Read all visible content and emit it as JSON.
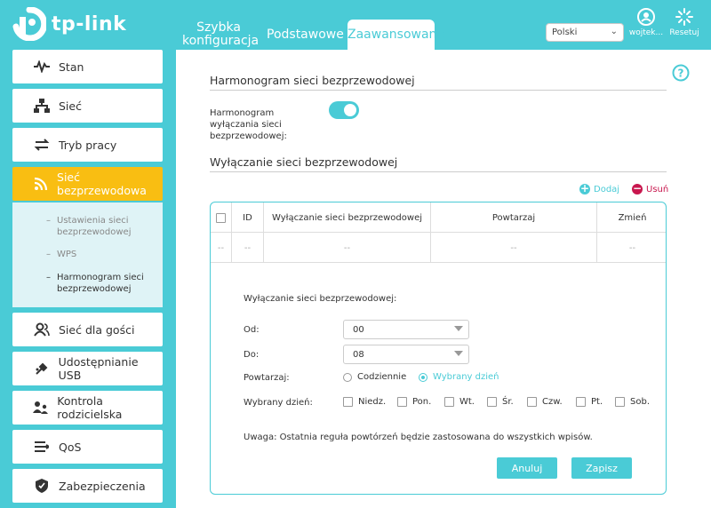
{
  "brand": {
    "name": "tp-link"
  },
  "nav": {
    "tabs": [
      {
        "label": "Szybka konfiguracja"
      },
      {
        "label": "Podstawowe"
      },
      {
        "label": "Zaawansowane"
      }
    ]
  },
  "header": {
    "language": "Polski",
    "user_label": "wojtek...",
    "reset_label": "Resetuj"
  },
  "sidebar": {
    "items": [
      {
        "label": "Stan",
        "icon": "pulse-icon"
      },
      {
        "label": "Sieć",
        "icon": "network-icon"
      },
      {
        "label": "Tryb pracy",
        "icon": "mode-icon"
      },
      {
        "label": "Sieć bezprzewodowa",
        "icon": "wifi-icon"
      },
      {
        "label": "Sieć dla gości",
        "icon": "guests-icon"
      },
      {
        "label": "Udostępnianie USB",
        "icon": "usb-icon"
      },
      {
        "label": "Kontrola rodzicielska",
        "icon": "parental-icon"
      },
      {
        "label": "QoS",
        "icon": "qos-icon"
      },
      {
        "label": "Zabezpieczenia",
        "icon": "shield-icon"
      }
    ],
    "submenu": [
      {
        "label": "Ustawienia sieci bezprzewodowej"
      },
      {
        "label": "WPS"
      },
      {
        "label": "Harmonogram sieci bezprzewodowej"
      }
    ]
  },
  "main": {
    "section1_title": "Harmonogram sieci bezprzewodowej",
    "toggle_label": "Harmonogram wyłączania sieci bezprzewodowej:",
    "section2_title": "Wyłączanie sieci bezprzewodowej",
    "add_label": "Dodaj",
    "delete_label": "Usuń",
    "table": {
      "headers": [
        "ID",
        "Wyłączanie sieci bezprzewodowej",
        "Powtarzaj",
        "Zmień"
      ],
      "row": [
        "--",
        "--",
        "--",
        "--",
        "--"
      ]
    },
    "form": {
      "title": "Wyłączanie sieci bezprzewodowej:",
      "from_label": "Od:",
      "from_value": "00",
      "to_label": "Do:",
      "to_value": "08",
      "repeat_label": "Powtarzaj:",
      "repeat_daily": "Codziennie",
      "repeat_selected": "Wybrany dzień",
      "days_label": "Wybrany dzień:",
      "days": [
        "Niedz.",
        "Pon.",
        "Wt.",
        "Śr.",
        "Czw.",
        "Pt.",
        "Sob."
      ],
      "note": "Uwaga: Ostatnia reguła powtórzeń będzie zastosowana do wszystkich wpisów.",
      "cancel_label": "Anuluj",
      "save_label": "Zapisz"
    }
  },
  "colors": {
    "accent": "#4acbd6",
    "active": "#f9be12",
    "delete": "#c8174e"
  }
}
